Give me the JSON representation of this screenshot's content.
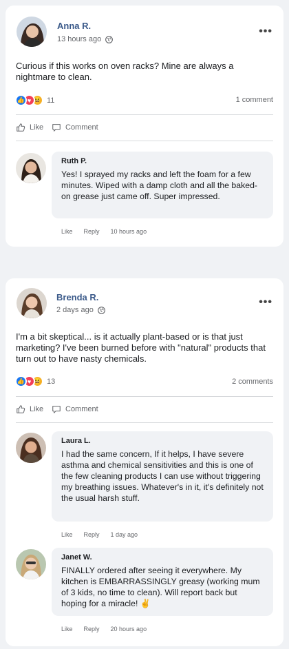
{
  "posts": [
    {
      "author": "Anna R.",
      "time": "13 hours ago",
      "text": "Curious if this works on oven racks? Mine are always a nightmare to clean.",
      "reaction_count": "11",
      "comment_count": "1 comment",
      "comments": [
        {
          "author": "Ruth P.",
          "text": "Yes! I sprayed my racks and left the foam for a few minutes. Wiped with a damp cloth and all the baked-on grease just came off. Super impressed.",
          "time": "10 hours ago"
        }
      ]
    },
    {
      "author": "Brenda R.",
      "time": "2 days ago",
      "text": "I'm a bit skeptical... is it actually plant-based or is that just marketing? I've been burned before with \"natural\" products that turn out to have nasty chemicals.",
      "reaction_count": "13",
      "comment_count": "2 comments",
      "comments": [
        {
          "author": "Laura L.",
          "text": "I had the same concern, If it helps, I have severe asthma and chemical sensitivities and this is one of the few cleaning products I can use without triggering my breathing issues. Whatever's in it, it's definitely not the usual harsh stuff.",
          "time": "1 day ago"
        },
        {
          "author": "Janet W.",
          "text": "FINALLY ordered after seeing it everywhere. My kitchen is EMBARRASSINGLY greasy (working mum of 3 kids, no time to clean). Will report back but hoping for a miracle! ✌",
          "time": "20 hours ago"
        }
      ]
    }
  ],
  "labels": {
    "like": "Like",
    "comment": "Comment",
    "reply": "Reply",
    "more": "•••"
  },
  "icons": {
    "privacy": "globe-icon",
    "like": "thumbs-up-icon",
    "comment": "speech-bubble-icon",
    "reaction_like": "like-reaction-icon",
    "reaction_love": "love-reaction-icon",
    "reaction_haha": "haha-reaction-icon"
  },
  "colors": {
    "author_name": "#3b5a8a",
    "like_reaction": "#1877f2",
    "love_reaction": "#f33e58",
    "haha_reaction": "#f7b125",
    "page_background": "#f0f2f5"
  }
}
